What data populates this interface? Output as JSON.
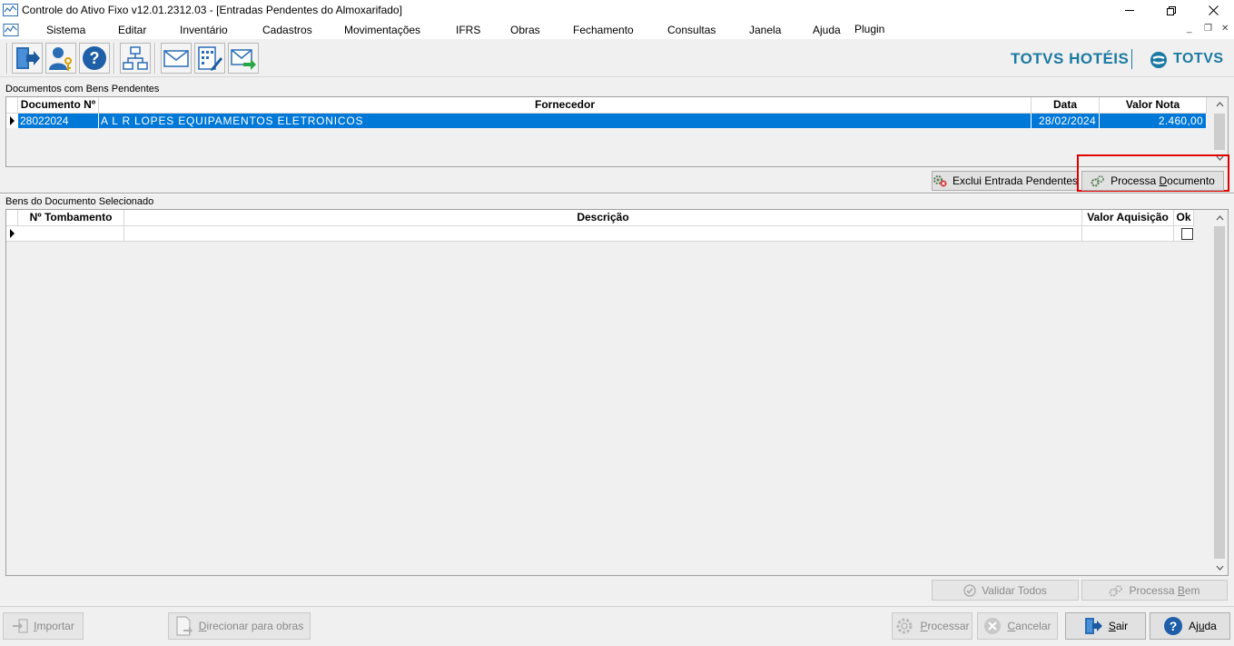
{
  "window": {
    "title": "Controle do Ativo Fixo v12.01.2312.03 - [Entradas Pendentes do Almoxarifado]",
    "minimize": "—",
    "restore": "❐",
    "close": "✕"
  },
  "menu": {
    "items": [
      "Sistema",
      "Editar",
      "Inventário",
      "Cadastros",
      "Movimentações",
      "IFRS",
      "Obras",
      "Fechamento",
      "Consultas",
      "Janela",
      "Ajuda",
      "Plugin"
    ],
    "mdi_minimize": "_",
    "mdi_restore": "❐",
    "mdi_close": "✕"
  },
  "toolbar": {
    "icons": [
      "exit-icon",
      "users-key-icon",
      "help-icon",
      "org-chart-icon",
      "mail-icon",
      "calc-edit-icon",
      "mail-send-icon"
    ]
  },
  "brand": {
    "hotel": "TOTVS HOTÉIS",
    "totvs": "TOTVS",
    "color": "#1b7aa2"
  },
  "documents": {
    "label": "Documentos com Bens Pendentes",
    "columns": [
      "Documento Nº",
      "Fornecedor",
      "Data",
      "Valor Nota"
    ],
    "rows": [
      {
        "documento": "28022024",
        "fornecedor": "A L R LOPES EQUIPAMENTOS ELETRONICOS",
        "data": "28/02/2024",
        "valor": "2.460,00"
      }
    ],
    "exclude_button": "Exclui Entrada Pendentes",
    "process_button_prefix": "Processa ",
    "process_button_accel": "D",
    "process_button_rest": "ocumento",
    "highlight_color": "#e00000"
  },
  "goods": {
    "label": "Bens do Documento Selecionado",
    "columns": [
      "Nº Tombamento",
      "Descrição",
      "Valor Aquisição",
      "Ok"
    ],
    "validate_all": "Validar Todos",
    "process_good_prefix": "Processa ",
    "process_good_accel": "B",
    "process_good_rest": "em"
  },
  "footer": {
    "importar_accel": "I",
    "importar_rest": "mportar",
    "direcionar_accel": "D",
    "direcionar_rest": "irecionar para obras",
    "processar_accel": "P",
    "processar_rest": "rocessar",
    "cancelar_accel": "C",
    "cancelar_rest": "ancelar",
    "sair_accel": "S",
    "sair_rest": "air",
    "ajuda_prefix": "Aj",
    "ajuda_accel": "u",
    "ajuda_rest": "da"
  },
  "colors": {
    "selection": "#0078d7",
    "accent": "#1b7aa2"
  }
}
